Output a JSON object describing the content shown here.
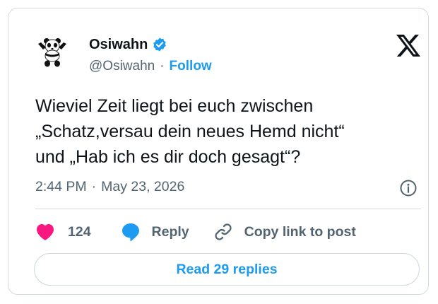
{
  "author": {
    "name": "Osiwahn",
    "handle": "@Osiwahn",
    "separator": "·",
    "follow_label": "Follow",
    "verified": true,
    "avatar_icon": "panda-avatar-icon"
  },
  "platform_icon": "x-logo-icon",
  "tweet": {
    "lines": [
      "Wieviel Zeit liegt bei euch zwischen",
      "„Schatz,versau dein neues Hemd nicht“",
      "und „Hab ich es dir doch gesagt“?"
    ],
    "time": "2:44 PM",
    "separator": "·",
    "date": "May 23, 2026"
  },
  "actions": {
    "like_count": "124",
    "reply_label": "Reply",
    "copy_label": "Copy link to post"
  },
  "read_replies_label": "Read 29 replies",
  "colors": {
    "accent": "#1d9bf0",
    "like": "#f91880",
    "text": "#0f1419",
    "muted": "#536471",
    "border": "#cfd9de"
  }
}
